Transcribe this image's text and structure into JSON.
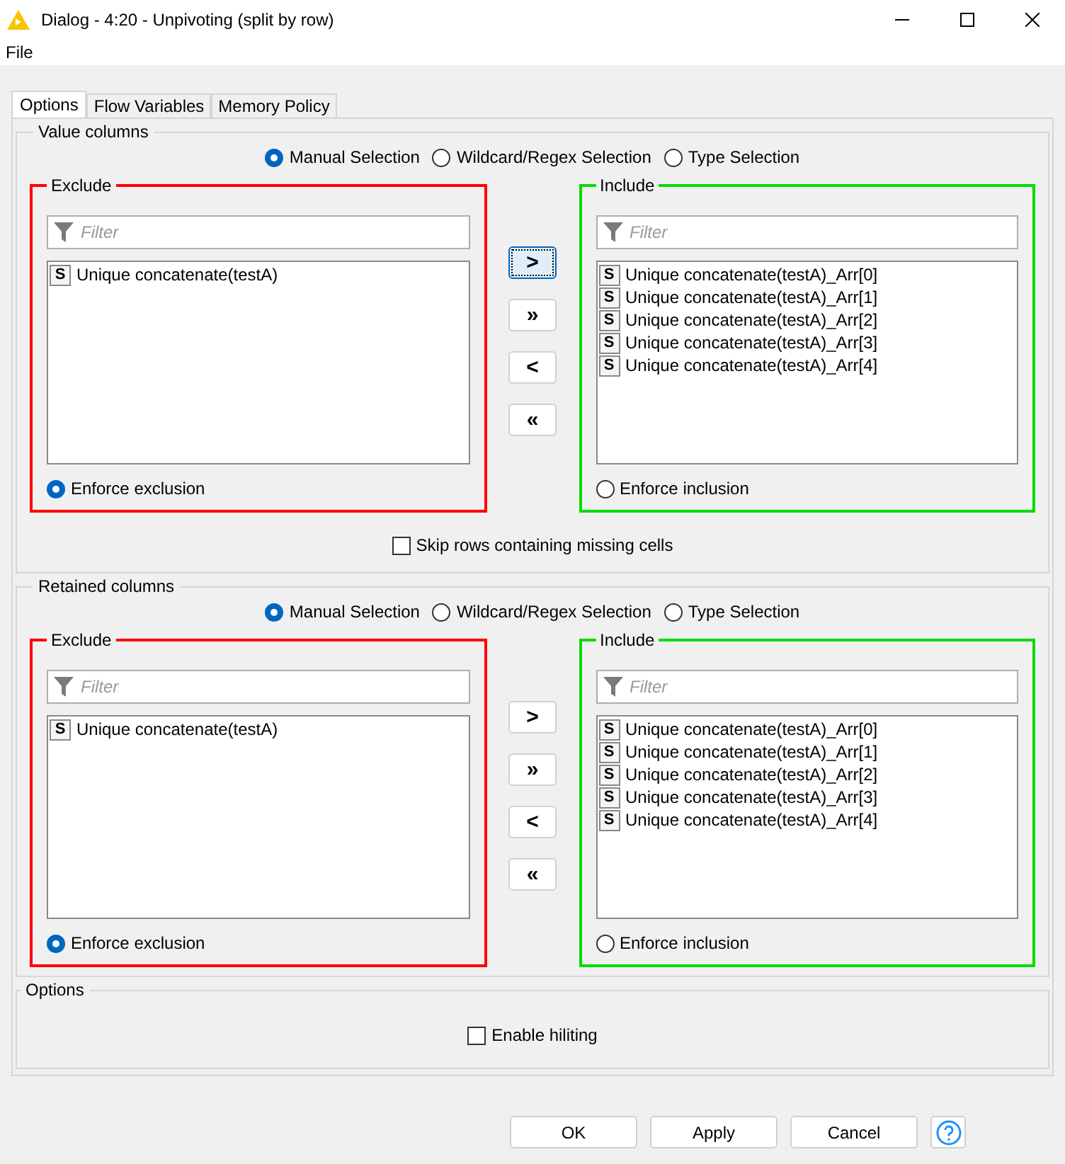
{
  "window": {
    "title": "Dialog - 4:20 - Unpivoting (split by row)"
  },
  "menu": [
    "File"
  ],
  "tabs": [
    {
      "label": "Options",
      "selected": true
    },
    {
      "label": "Flow Variables",
      "selected": false
    },
    {
      "label": "Memory Policy",
      "selected": false
    }
  ],
  "groups": [
    {
      "title": "Value columns",
      "modes": [
        {
          "label": "Manual Selection",
          "selected": true
        },
        {
          "label": "Wildcard/Regex Selection",
          "selected": false
        },
        {
          "label": "Type Selection",
          "selected": false
        }
      ],
      "exclude": {
        "title": "Exclude",
        "filter_placeholder": "Filter",
        "items": [
          {
            "type": "S",
            "name": "Unique concatenate(testA)"
          }
        ],
        "enforce": {
          "label": "Enforce exclusion",
          "selected": true
        }
      },
      "move_buttons": [
        {
          "label": ">",
          "focused": true
        },
        {
          "label": "»",
          "focused": false
        },
        {
          "label": "<",
          "focused": false
        },
        {
          "label": "«",
          "focused": false
        }
      ],
      "include": {
        "title": "Include",
        "filter_placeholder": "Filter",
        "items": [
          {
            "type": "S",
            "name": "Unique concatenate(testA)_Arr[0]"
          },
          {
            "type": "S",
            "name": "Unique concatenate(testA)_Arr[1]"
          },
          {
            "type": "S",
            "name": "Unique concatenate(testA)_Arr[2]"
          },
          {
            "type": "S",
            "name": "Unique concatenate(testA)_Arr[3]"
          },
          {
            "type": "S",
            "name": "Unique concatenate(testA)_Arr[4]"
          }
        ],
        "enforce": {
          "label": "Enforce inclusion",
          "selected": false
        }
      },
      "checkbox": {
        "label": "Skip rows containing missing cells",
        "checked": false
      }
    },
    {
      "title": "Retained columns",
      "modes": [
        {
          "label": "Manual Selection",
          "selected": true
        },
        {
          "label": "Wildcard/Regex Selection",
          "selected": false
        },
        {
          "label": "Type Selection",
          "selected": false
        }
      ],
      "exclude": {
        "title": "Exclude",
        "filter_placeholder": "Filter",
        "items": [
          {
            "type": "S",
            "name": "Unique concatenate(testA)"
          }
        ],
        "enforce": {
          "label": "Enforce exclusion",
          "selected": true
        }
      },
      "move_buttons": [
        {
          "label": ">",
          "focused": false
        },
        {
          "label": "»",
          "focused": false
        },
        {
          "label": "<",
          "focused": false
        },
        {
          "label": "«",
          "focused": false
        }
      ],
      "include": {
        "title": "Include",
        "filter_placeholder": "Filter",
        "items": [
          {
            "type": "S",
            "name": "Unique concatenate(testA)_Arr[0]"
          },
          {
            "type": "S",
            "name": "Unique concatenate(testA)_Arr[1]"
          },
          {
            "type": "S",
            "name": "Unique concatenate(testA)_Arr[2]"
          },
          {
            "type": "S",
            "name": "Unique concatenate(testA)_Arr[3]"
          },
          {
            "type": "S",
            "name": "Unique concatenate(testA)_Arr[4]"
          }
        ],
        "enforce": {
          "label": "Enforce inclusion",
          "selected": false
        }
      }
    }
  ],
  "options": {
    "title": "Options",
    "checkbox": {
      "label": "Enable hiliting",
      "checked": false
    }
  },
  "buttons": [
    "OK",
    "Apply",
    "Cancel"
  ]
}
